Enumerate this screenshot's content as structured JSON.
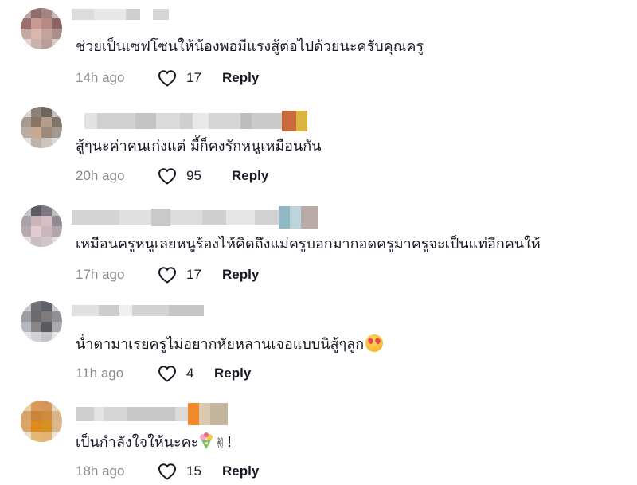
{
  "comments": [
    {
      "text": "ช่วยเป็นเซฟโซนให้น้องพอมีแรงสู้ต่อไปด้วยนะครับคุณครู",
      "time": "14h ago",
      "likes": "17",
      "reply": "Reply"
    },
    {
      "text": "สู้ๆนะค่าคนเก่งแต่ มี้ก็คงรักหนูเหมือนกัน",
      "time": "20h ago",
      "likes": "95",
      "reply": "Reply"
    },
    {
      "text": "เหมือนครูหนูเลยหนูร้องไห้คิดถึงแม่ครูบอกมากอดครูมาครูจะเป็นแท่อีกคนให้",
      "time": "17h ago",
      "likes": "17",
      "reply": "Reply"
    },
    {
      "text": "น่ำตามาเรยครูไม่อยากหัยหลานเจอแบบนิสู้ๆลูก",
      "time": "11h ago",
      "likes": "4",
      "reply": "Reply"
    },
    {
      "text": "เป็นกำลังใจให้นะคะ",
      "text_suffix": "!",
      "time": "18h ago",
      "likes": "15",
      "reply": "Reply"
    }
  ],
  "icons": {
    "like": "heart-outline-icon",
    "emoji_4": "smiling-face-with-hearts-icon",
    "emoji_5a": "bouquet-icon",
    "emoji_5b": "victory-hand-icon"
  },
  "colors": {
    "text": "#161823",
    "secondary": "#8a8b91",
    "background": "#ffffff"
  }
}
